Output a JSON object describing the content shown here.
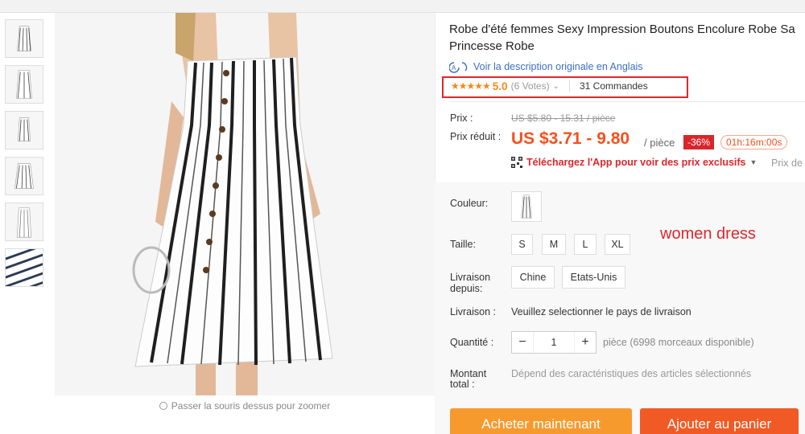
{
  "product": {
    "title_line1": "Robe d'été femmes Sexy Impression Boutons Encolure Robe Sa",
    "title_line2": "Princesse Robe",
    "translate_link": "Voir la description originale en Anglais",
    "rating": {
      "stars": "★★★★★",
      "score": "5.0",
      "votes": "(6 Votes)",
      "orders": "31 Commandes"
    }
  },
  "pricing": {
    "prix_label": "Prix :",
    "prix_original": "US $5.80 - 15.31 / pièce",
    "prix_reduit_label": "Prix réduit :",
    "price": "US $3.71 - 9.80",
    "per_unit": "/ pièce",
    "discount": "-36%",
    "timer": "01h:16m:00s",
    "app_promo": "Téléchargez l'App pour voir des prix exclusifs",
    "prix_de": "Prix de"
  },
  "options": {
    "color_label": "Couleur:",
    "size_label": "Taille:",
    "sizes": [
      "S",
      "M",
      "L",
      "XL"
    ],
    "ship_from_label_1": "Livraison",
    "ship_from_label_2": "depuis:",
    "ship_from": [
      "Chine",
      "Etats-Unis"
    ],
    "shipping_label": "Livraison :",
    "shipping_text": "Veuillez selectionner le pays de livraison",
    "quantity_label": "Quantité :",
    "quantity_value": "1",
    "quantity_minus": "−",
    "quantity_plus": "+",
    "stock": "pièce (6998 morceaux disponible)",
    "total_label_1": "Montant",
    "total_label_2": "total :",
    "total_text": "Dépend des caractéristiques des articles sélectionnés"
  },
  "annotation": "women dress",
  "zoom_hint": "Passer la souris dessus pour zoomer",
  "actions": {
    "buy": "Acheter maintenant",
    "cart": "Ajouter au panier"
  },
  "colors": {
    "accent_orange": "#f4501e",
    "buy_button": "#f79a2e",
    "cart_button": "#f15a24",
    "highlight_red": "#e0262b"
  }
}
